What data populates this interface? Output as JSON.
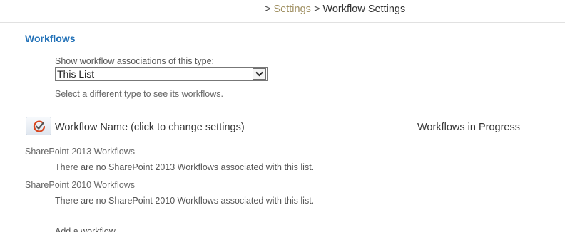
{
  "breadcrumb": {
    "separator": ">",
    "items": [
      "Settings",
      "Workflow Settings"
    ]
  },
  "section": {
    "title": "Workflows"
  },
  "filter": {
    "label": "Show workflow associations of this type:",
    "selected": "This List",
    "hint": "Select a different type to see its workflows."
  },
  "table": {
    "columns": {
      "name": "Workflow Name (click to change settings)",
      "progress": "Workflows in Progress"
    },
    "groups": [
      {
        "title": "SharePoint 2013 Workflows",
        "empty_message": "There are no SharePoint 2013 Workflows associated with this list."
      },
      {
        "title": "SharePoint 2010 Workflows",
        "empty_message": "There are no SharePoint 2010 Workflows associated with this list."
      }
    ]
  },
  "footer": {
    "link_label": "Add a workflow"
  },
  "colors": {
    "section_title": "#2372b8",
    "breadcrumb_link": "#a09062",
    "workflow_icon": "#d9441c"
  },
  "icons": {
    "workflow_header": "workflow-check-icon",
    "select_arrow": "chevron-down-icon"
  }
}
